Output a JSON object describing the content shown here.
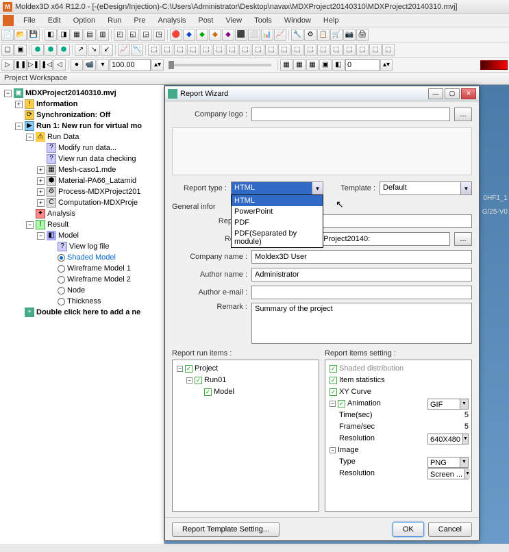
{
  "title": "Moldex3D  x64 R12.0 - [-(eDesign/Injection)-C:\\Users\\Administrator\\Desktop\\navax\\MDXProject20140310\\MDXProject20140310.mvj]",
  "menu": [
    "File",
    "Edit",
    "Option",
    "Run",
    "Pre",
    "Analysis",
    "Post",
    "View",
    "Tools",
    "Window",
    "Help"
  ],
  "toolbar_value": "100.00",
  "toolbar_num": "0",
  "workspace_header": "Project Workspace",
  "tree": {
    "root": "MDXProject20140310.mvj",
    "info": "Information",
    "sync": "Synchronization: Off",
    "run1": "Run 1: New run for virtual mo",
    "rundata": "Run Data",
    "modify": "Modify run data...",
    "viewrun": "View run data checking",
    "mesh": "Mesh-caso1.mde",
    "material": "Material-PA66_Latamid",
    "process": "Process-MDXProject201",
    "computation": "Computation-MDXProje",
    "analysis": "Analysis",
    "result": "Result",
    "model": "Model",
    "viewlog": "View log file",
    "shaded": "Shaded Model",
    "wire1": "Wireframe Model 1",
    "wire2": "Wireframe Model 2",
    "node": "Node",
    "thickness": "Thickness",
    "dblclick": "Double click here to add a ne"
  },
  "dialog": {
    "title": "Report Wizard",
    "company_logo_label": "Company logo :",
    "report_type_label": "Report type :",
    "report_type_value": "HTML",
    "template_label": "Template :",
    "template_value": "Default",
    "dropdown_options": [
      "HTML",
      "PowerPoint",
      "PDF",
      "PDF(Separated by module)"
    ],
    "general_info": "General infor",
    "report_n_label": "Report n",
    "report_label": "Report",
    "report_path": "Desktop\\navax\\MDXProject20140:",
    "company_name_label": "Company name :",
    "company_name_value": "Moldex3D User",
    "author_name_label": "Author name :",
    "author_name_value": "Administrator",
    "author_email_label": "Author e-mail :",
    "author_email_value": "",
    "remark_label": "Remark :",
    "remark_value": "Summary of the project",
    "run_items_header": "Report run items :",
    "items_setting_header": "Report items setting :",
    "run_items": {
      "project": "Project",
      "run01": "Run01",
      "model": "Model"
    },
    "settings": {
      "shaded": "Shaded distribution",
      "item_stats": "Item statistics",
      "xy_curve": "XY Curve",
      "animation": "Animation",
      "anim_format": "GIF",
      "time_sec_label": "Time(sec)",
      "time_sec": "5",
      "frame_sec_label": "Frame/sec",
      "frame_sec": "5",
      "resolution_label": "Resolution",
      "anim_resolution": "640X480",
      "image": "Image",
      "type_label": "Type",
      "img_type": "PNG",
      "img_resolution": "Screen ..."
    },
    "footer": {
      "template_setting": "Report Template Setting...",
      "ok": "OK",
      "cancel": "Cancel"
    }
  },
  "bg": {
    "l1": "0HF1_1",
    "l2": "G/25-V0"
  }
}
